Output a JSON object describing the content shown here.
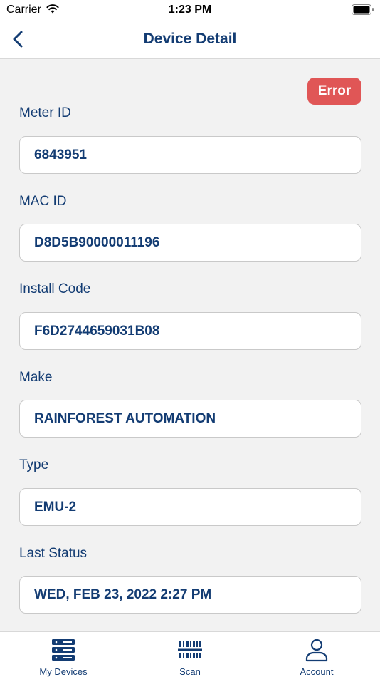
{
  "status_bar": {
    "carrier": "Carrier",
    "time": "1:23 PM"
  },
  "nav": {
    "title": "Device Detail",
    "back_icon": "chevron-left-icon"
  },
  "badge": {
    "label": "Error",
    "color": "#e05656"
  },
  "fields": [
    {
      "label": "Meter ID",
      "value": "6843951"
    },
    {
      "label": "MAC ID",
      "value": "D8D5B90000011196"
    },
    {
      "label": "Install Code",
      "value": "F6D2744659031B08"
    },
    {
      "label": "Make",
      "value": "RAINFOREST AUTOMATION"
    },
    {
      "label": "Type",
      "value": "EMU-2"
    },
    {
      "label": "Last Status",
      "value": "WED, FEB 23, 2022 2:27 PM"
    }
  ],
  "tabs": [
    {
      "label": "My Devices",
      "icon": "server-stack-icon"
    },
    {
      "label": "Scan",
      "icon": "barcode-icon"
    },
    {
      "label": "Account",
      "icon": "person-icon"
    }
  ],
  "colors": {
    "primary": "#133c73",
    "background": "#f2f2f2",
    "error": "#e05656"
  }
}
